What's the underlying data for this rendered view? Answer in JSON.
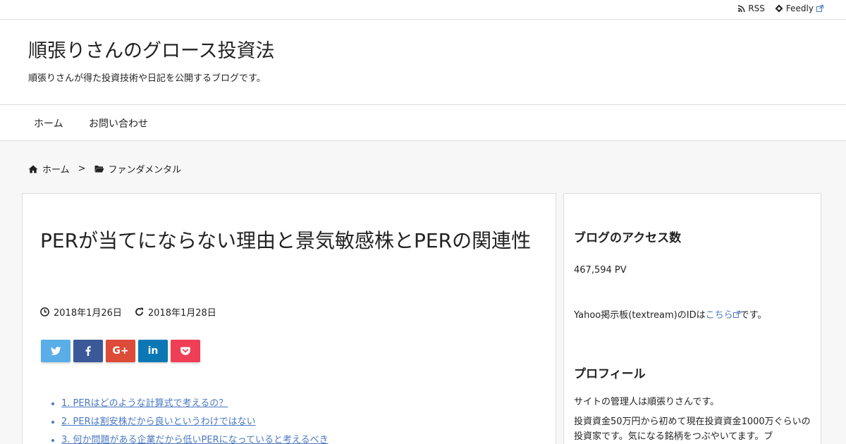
{
  "topbar": {
    "rss_label": "RSS",
    "feedly_label": "Feedly"
  },
  "header": {
    "site_title": "順張りさんのグロース投資法",
    "site_description": "順張りさんが得た投資技術や日記を公開するブログです。"
  },
  "nav": {
    "items": [
      {
        "label": "ホーム"
      },
      {
        "label": "お問い合わせ"
      }
    ]
  },
  "breadcrumb": {
    "home": "ホーム",
    "separator": ">",
    "category": "ファンダメンタル"
  },
  "post": {
    "title": "PERが当てにならない理由と景気敏感株とPERの関連性",
    "published": "2018年1月26日",
    "updated": "2018年1月28日",
    "share_buttons": [
      {
        "icon": "twitter-icon",
        "color": "#5aaee8"
      },
      {
        "icon": "facebook-icon",
        "color": "#3b5998"
      },
      {
        "icon": "google-plus-icon",
        "color": "#dd4b39",
        "label": "G+"
      },
      {
        "icon": "linkedin-icon",
        "color": "#0b78b5",
        "label": "in"
      },
      {
        "icon": "pocket-icon",
        "color": "#ef3f56"
      }
    ],
    "toc": [
      "1. PERはどのような計算式で考えるの？",
      "2. PERは割安株だから良いというわけではない",
      "3. 何か問題がある企業だから低いPERになっていると考えるべき"
    ]
  },
  "sidebar": {
    "access_heading": "ブログのアクセス数",
    "access_count": "467,594 PV",
    "yahoo_prefix": "Yahoo掲示板(textream)のIDは",
    "yahoo_link": "こちら",
    "yahoo_suffix": "です。",
    "profile_heading": "プロフィール",
    "profile_line1": "サイトの管理人は順張りさんです。",
    "profile_line2": "投資資金50万円から初めて現在投資資金1000万ぐらいの投資家です。気になる銘柄をつぶやいてます。ブ"
  },
  "colors": {
    "link": "#4a78c0",
    "border": "#dddddd",
    "background": "#f7f7f7"
  }
}
